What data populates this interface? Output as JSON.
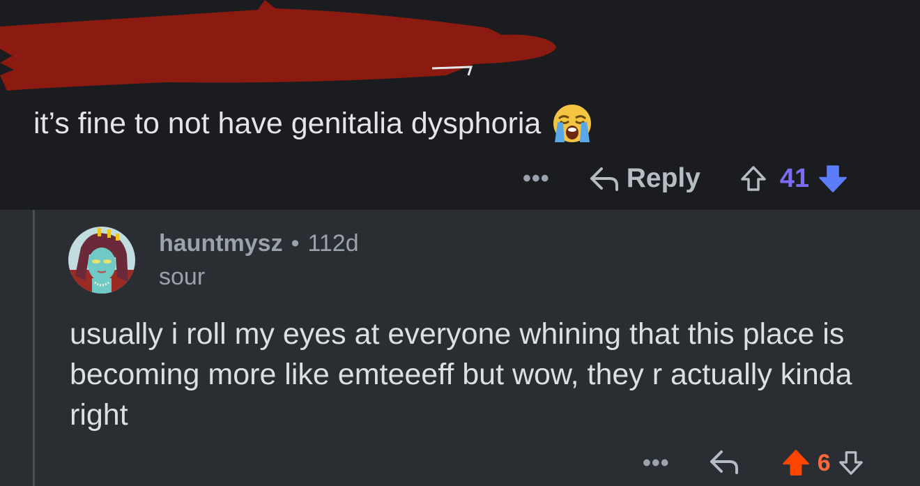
{
  "parent_comment": {
    "body": "it’s fine to not have genitalia dysphoria",
    "emoji_icon": "loudly-crying-face-emoji",
    "actions": {
      "more_label": "•••",
      "reply_label": "Reply",
      "vote_count": "41"
    }
  },
  "reply_comment": {
    "username": "hauntmysz",
    "separator": "•",
    "age": "112d",
    "flair": "sour",
    "body": "usually i roll my eyes at everyone whining that this place is becoming more like emteeeff but wow, they r actually kinda right",
    "actions": {
      "more_label": "•••",
      "vote_count": "6"
    }
  },
  "colors": {
    "upvote_active": "#ff4500",
    "downvote_active": "#5c7cfa",
    "redaction": "#8b1a10"
  }
}
